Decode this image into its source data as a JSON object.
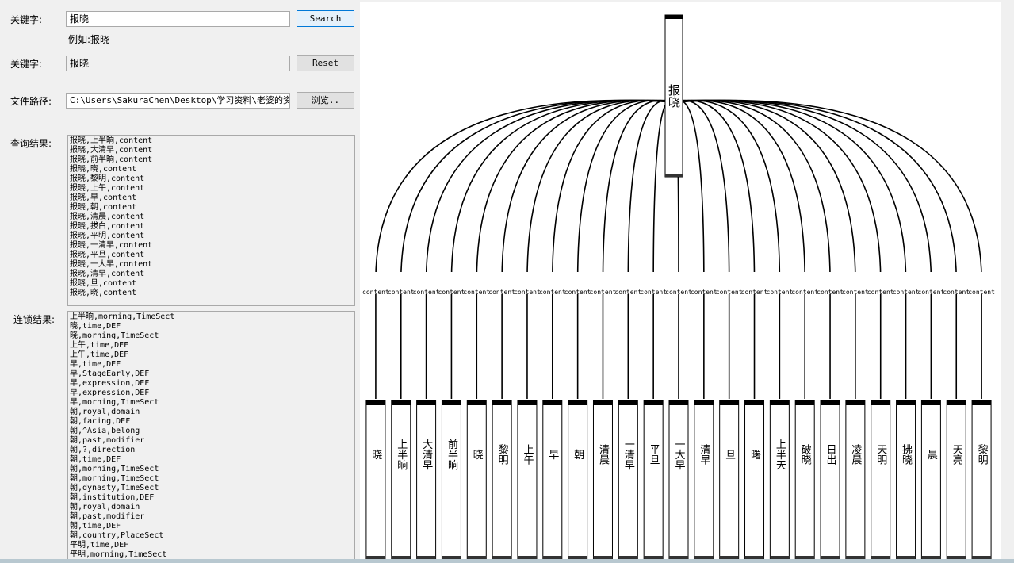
{
  "form": {
    "keyword_label_1": "关键字:",
    "keyword_value_1": "报晓",
    "search_button": "Search",
    "example_text": "例如:报晓",
    "keyword_label_2": "关键字:",
    "keyword_value_2": "报晓",
    "reset_button": "Reset",
    "path_label": "文件路径:",
    "path_value": "C:\\Users\\SakuraChen\\Desktop\\学习资料\\老婆的资料",
    "browse_button": "浏览..",
    "query_label": "查询结果:",
    "chain_label": "连锁结果:"
  },
  "query_results": [
    "报晓,上半晌,content",
    "报晓,大清早,content",
    "报晓,前半晌,content",
    "报晓,晓,content",
    "报晓,黎明,content",
    "报晓,上午,content",
    "报晓,早,content",
    "报晓,朝,content",
    "报晓,清晨,content",
    "报晓,拔白,content",
    "报晓,平明,content",
    "报晓,一清早,content",
    "报晓,平旦,content",
    "报晓,一大早,content",
    "报晓,清早,content",
    "报晓,旦,content",
    "报晓,晓,content"
  ],
  "chain_results": [
    "上半晌,morning,TimeSect",
    "晓,time,DEF",
    "晓,morning,TimeSect",
    "上午,time,DEF",
    "上午,time,DEF",
    "早,time,DEF",
    "早,StageEarly,DEF",
    "早,expression,DEF",
    "早,expression,DEF",
    "早,morning,TimeSect",
    "朝,royal,domain",
    "朝,facing,DEF",
    "朝,^Asia,belong",
    "朝,past,modifier",
    "朝,?,direction",
    "朝,time,DEF",
    "朝,morning,TimeSect",
    "朝,morning,TimeSect",
    "朝,dynasty,TimeSect",
    "朝,institution,DEF",
    "朝,royal,domain",
    "朝,past,modifier",
    "朝,time,DEF",
    "朝,country,PlaceSect",
    "平明,time,DEF",
    "平明,morning,TimeSect"
  ],
  "graph": {
    "root": "报晓",
    "edge_label": "content",
    "edge_labels": [
      "content",
      "content",
      "content",
      "content",
      "content",
      "content",
      "content",
      "content",
      "content",
      "content",
      "content",
      "content",
      "content",
      "content",
      "content",
      "content",
      "content",
      "content",
      "content",
      "content",
      "content",
      "content",
      "content",
      "content",
      "content"
    ],
    "nodes": [
      "晓",
      "上半晌",
      "大清早",
      "前半晌",
      "晓",
      "黎明",
      "上午",
      "早",
      "朝",
      "清晨",
      "一清早",
      "平旦",
      "一大早",
      "清早",
      "旦",
      "曙",
      "上半天",
      "破晓",
      "日出",
      "凌晨",
      "天明",
      "拂晓",
      "晨",
      "天亮",
      "黎明"
    ]
  }
}
